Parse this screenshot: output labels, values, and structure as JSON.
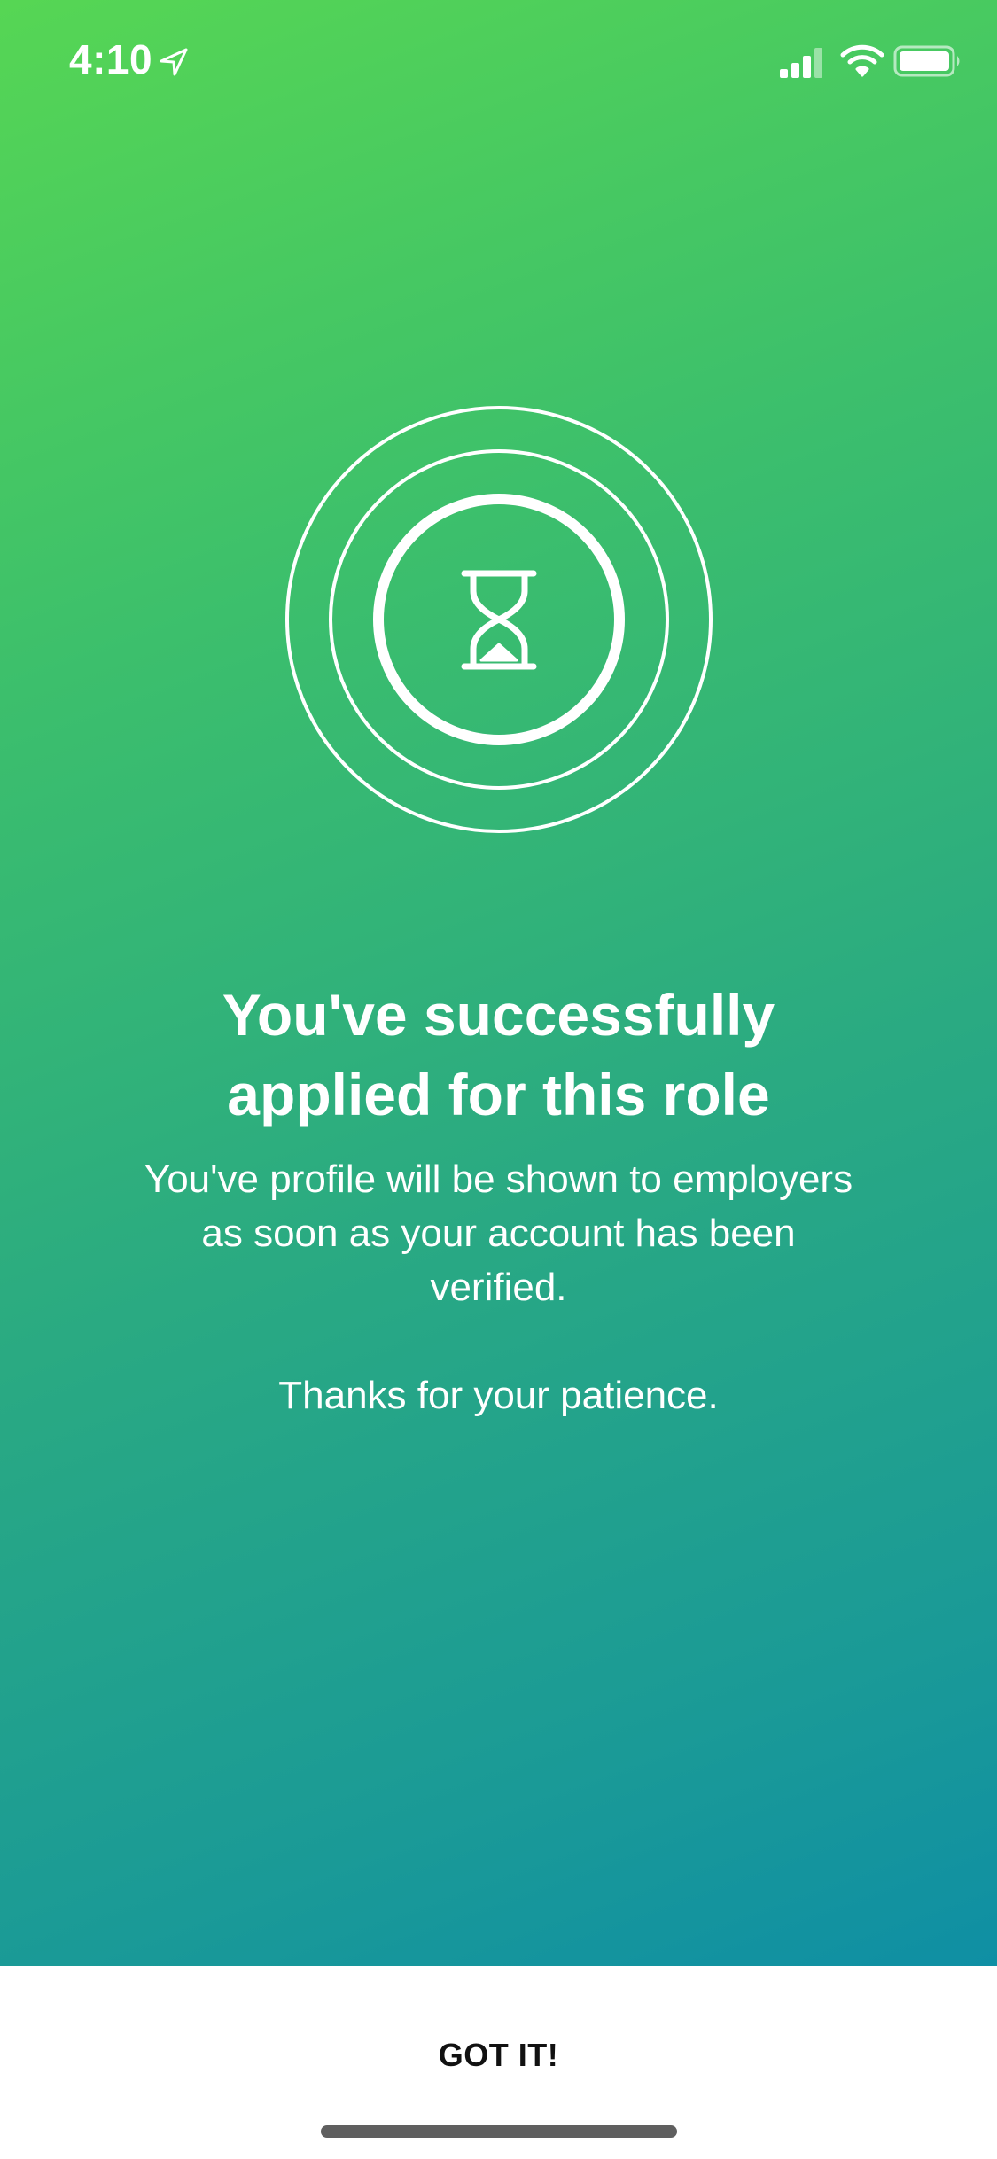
{
  "status_bar": {
    "time": "4:10",
    "icons": [
      "location-arrow-icon",
      "cellular-signal-icon",
      "wifi-icon",
      "battery-icon"
    ]
  },
  "graphic": {
    "icon": "hourglass-icon"
  },
  "content": {
    "title_line1": "You've successfully",
    "title_line2": "applied for this role",
    "message": "You've profile will be shown to employers as soon as your account has been verified.",
    "thanks": "Thanks for your patience."
  },
  "actions": {
    "got_it_label": "GOT IT!"
  },
  "colors": {
    "gradient_start": "#56d654",
    "gradient_end": "#0f8fa4",
    "text": "#ffffff",
    "button_background": "#ffffff",
    "button_text": "#111111"
  }
}
